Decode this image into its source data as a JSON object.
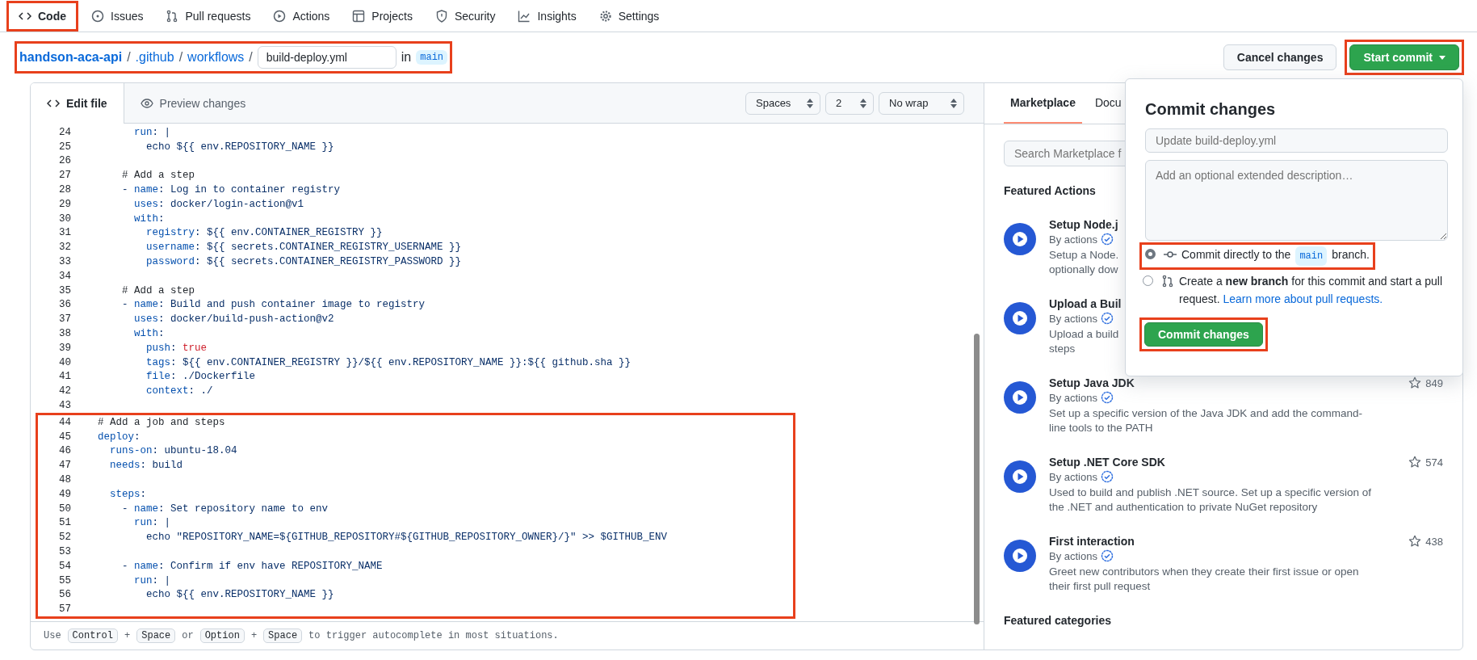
{
  "nav_tabs": [
    {
      "label": "Code",
      "selected": true,
      "highlighted": true
    },
    {
      "label": "Issues",
      "selected": false,
      "highlighted": false
    },
    {
      "label": "Pull requests",
      "selected": false,
      "highlighted": false
    },
    {
      "label": "Actions",
      "selected": false,
      "highlighted": false
    },
    {
      "label": "Projects",
      "selected": false,
      "highlighted": false
    },
    {
      "label": "Security",
      "selected": false,
      "highlighted": false
    },
    {
      "label": "Insights",
      "selected": false,
      "highlighted": false
    },
    {
      "label": "Settings",
      "selected": false,
      "highlighted": false
    }
  ],
  "breadcrumb": {
    "highlighted": true,
    "repo": "handson-aca-api",
    "separator": "/",
    "folders": [
      ".github",
      "workflows"
    ],
    "filename": "build-deploy.yml",
    "in_label": "in",
    "branch": "main"
  },
  "actions": {
    "cancel": "Cancel changes",
    "start_commit": {
      "label": "Start commit",
      "highlighted": true
    }
  },
  "editor": {
    "tabs": [
      {
        "label": "Edit file",
        "selected": true
      },
      {
        "label": "Preview changes",
        "selected": false
      }
    ],
    "selects": [
      "Spaces",
      "2",
      "No wrap"
    ],
    "code_blocks": [
      {
        "highlighted": false,
        "lines": [
          {
            "number": "24",
            "parts": [
              {
                "kind": "key",
                "text": "        run"
              },
              {
                "kind": "value",
                "text": ": |"
              }
            ]
          },
          {
            "number": "25",
            "parts": [
              {
                "kind": "value",
                "text": "          echo ${{ env.REPOSITORY_NAME }}"
              }
            ]
          },
          {
            "number": "26"
          },
          {
            "number": "27",
            "parts": [
              {
                "kind": "comment",
                "text": "      # Add a step"
              }
            ]
          },
          {
            "number": "28",
            "parts": [
              {
                "kind": "value",
                "text": "      - "
              },
              {
                "kind": "key",
                "text": "name"
              },
              {
                "kind": "value",
                "text": ": Log in to container registry"
              }
            ]
          },
          {
            "number": "29",
            "parts": [
              {
                "kind": "key",
                "text": "        uses"
              },
              {
                "kind": "value",
                "text": ": docker/login-action@v1"
              }
            ]
          },
          {
            "number": "30",
            "parts": [
              {
                "kind": "key",
                "text": "        with"
              },
              {
                "kind": "value",
                "text": ":"
              }
            ]
          },
          {
            "number": "31",
            "parts": [
              {
                "kind": "key",
                "text": "          registry"
              },
              {
                "kind": "value",
                "text": ": ${{ env.CONTAINER_REGISTRY }}"
              }
            ]
          },
          {
            "number": "32",
            "parts": [
              {
                "kind": "key",
                "text": "          username"
              },
              {
                "kind": "value",
                "text": ": ${{ secrets.CONTAINER_REGISTRY_USERNAME }}"
              }
            ]
          },
          {
            "number": "33",
            "parts": [
              {
                "kind": "key",
                "text": "          password"
              },
              {
                "kind": "value",
                "text": ": ${{ secrets.CONTAINER_REGISTRY_PASSWORD }}"
              }
            ]
          },
          {
            "number": "34"
          },
          {
            "number": "35",
            "parts": [
              {
                "kind": "comment",
                "text": "      # Add a step"
              }
            ]
          },
          {
            "number": "36",
            "parts": [
              {
                "kind": "value",
                "text": "      - "
              },
              {
                "kind": "key",
                "text": "name"
              },
              {
                "kind": "value",
                "text": ": Build and push container image to registry"
              }
            ]
          },
          {
            "number": "37",
            "parts": [
              {
                "kind": "key",
                "text": "        uses"
              },
              {
                "kind": "value",
                "text": ": docker/build-push-action@v2"
              }
            ]
          },
          {
            "number": "38",
            "parts": [
              {
                "kind": "key",
                "text": "        with"
              },
              {
                "kind": "value",
                "text": ":"
              }
            ]
          },
          {
            "number": "39",
            "parts": [
              {
                "kind": "key",
                "text": "          push"
              },
              {
                "kind": "value",
                "text": ": "
              },
              {
                "kind": "bool",
                "text": "true"
              }
            ]
          },
          {
            "number": "40",
            "parts": [
              {
                "kind": "key",
                "text": "          tags"
              },
              {
                "kind": "value",
                "text": ": ${{ env.CONTAINER_REGISTRY }}/${{ env.REPOSITORY_NAME }}:${{ github.sha }}"
              }
            ]
          },
          {
            "number": "41",
            "parts": [
              {
                "kind": "key",
                "text": "          file"
              },
              {
                "kind": "value",
                "text": ": ./Dockerfile"
              }
            ]
          },
          {
            "number": "42",
            "parts": [
              {
                "kind": "key",
                "text": "          context"
              },
              {
                "kind": "value",
                "text": ": ./"
              }
            ]
          },
          {
            "number": "43"
          }
        ]
      },
      {
        "highlighted": true,
        "lines": [
          {
            "number": "44",
            "parts": [
              {
                "kind": "comment",
                "text": "  # Add a job and steps"
              }
            ]
          },
          {
            "number": "45",
            "parts": [
              {
                "kind": "key",
                "text": "  deploy"
              },
              {
                "kind": "value",
                "text": ":"
              }
            ]
          },
          {
            "number": "46",
            "parts": [
              {
                "kind": "key",
                "text": "    runs-on"
              },
              {
                "kind": "value",
                "text": ": ubuntu-18.04"
              }
            ]
          },
          {
            "number": "47",
            "parts": [
              {
                "kind": "key",
                "text": "    needs"
              },
              {
                "kind": "value",
                "text": ": build"
              }
            ]
          },
          {
            "number": "48"
          },
          {
            "number": "49",
            "parts": [
              {
                "kind": "key",
                "text": "    steps"
              },
              {
                "kind": "value",
                "text": ":"
              }
            ]
          },
          {
            "number": "50",
            "parts": [
              {
                "kind": "value",
                "text": "      - "
              },
              {
                "kind": "key",
                "text": "name"
              },
              {
                "kind": "value",
                "text": ": Set repository name to env"
              }
            ]
          },
          {
            "number": "51",
            "parts": [
              {
                "kind": "key",
                "text": "        run"
              },
              {
                "kind": "value",
                "text": ": |"
              }
            ]
          },
          {
            "number": "52",
            "parts": [
              {
                "kind": "value",
                "text": "          echo \"REPOSITORY_NAME=${GITHUB_REPOSITORY#${GITHUB_REPOSITORY_OWNER}/}\" >> $GITHUB_ENV"
              }
            ]
          },
          {
            "number": "53"
          },
          {
            "number": "54",
            "parts": [
              {
                "kind": "value",
                "text": "      - "
              },
              {
                "kind": "key",
                "text": "name"
              },
              {
                "kind": "value",
                "text": ": Confirm if env have REPOSITORY_NAME"
              }
            ]
          },
          {
            "number": "55",
            "parts": [
              {
                "kind": "key",
                "text": "        run"
              },
              {
                "kind": "value",
                "text": ": |"
              }
            ]
          },
          {
            "number": "56",
            "parts": [
              {
                "kind": "value",
                "text": "          echo ${{ env.REPOSITORY_NAME }}"
              }
            ]
          },
          {
            "number": "57"
          }
        ]
      }
    ],
    "footer": [
      {
        "kind": "text",
        "text": "Use"
      },
      {
        "kind": "key",
        "text": "Control"
      },
      {
        "kind": "text",
        "text": "+"
      },
      {
        "kind": "key",
        "text": "Space"
      },
      {
        "kind": "text",
        "text": "or"
      },
      {
        "kind": "key",
        "text": "Option"
      },
      {
        "kind": "text",
        "text": "+"
      },
      {
        "kind": "key",
        "text": "Space"
      },
      {
        "kind": "text",
        "text": "to trigger autocomplete in most situations."
      }
    ]
  },
  "side_panel": {
    "tabs": [
      {
        "label": "Marketplace",
        "selected": true
      },
      {
        "label": "Docu",
        "selected": false
      }
    ],
    "search": {
      "placeholder": "Search Marketplace f"
    },
    "featured_heading": "Featured Actions",
    "items": [
      {
        "title": "Setup Node.j",
        "author": "By actions",
        "description": [
          "Setup a Node.",
          "optionally dow"
        ]
      },
      {
        "title": "Upload a Buil",
        "author": "By actions",
        "description": [
          "Upload a build",
          "steps"
        ]
      },
      {
        "title": "Setup Java JDK",
        "author": "By actions",
        "stars": "849",
        "description": [
          "Set up a specific version of the Java JDK and add the command-",
          "line tools to the PATH"
        ]
      },
      {
        "title": "Setup .NET Core SDK",
        "author": "By actions",
        "stars": "574",
        "description": [
          "Used to build and publish .NET source. Set up a specific version of",
          "the .NET and authentication to private NuGet repository"
        ]
      },
      {
        "title": "First interaction",
        "author": "By actions",
        "stars": "438",
        "description": [
          "Greet new contributors when they create their first issue or open",
          "their first pull request"
        ]
      }
    ],
    "categories_heading": "Featured categories"
  },
  "commit_popover": {
    "title": "Commit changes",
    "summary_placeholder": "Update build-deploy.yml",
    "description_placeholder": "Add an optional extended description…",
    "options": [
      {
        "kind": "direct",
        "selected": true,
        "highlighted": true,
        "text": "Commit directly to the",
        "branch": "main",
        "text_after": "branch."
      },
      {
        "kind": "new_branch",
        "selected": false,
        "highlighted": false,
        "text": "Create a **new branch** for this commit and start a pull request.",
        "link": "Learn more about pull requests."
      }
    ],
    "button": {
      "label": "Commit changes",
      "highlighted": true
    }
  }
}
